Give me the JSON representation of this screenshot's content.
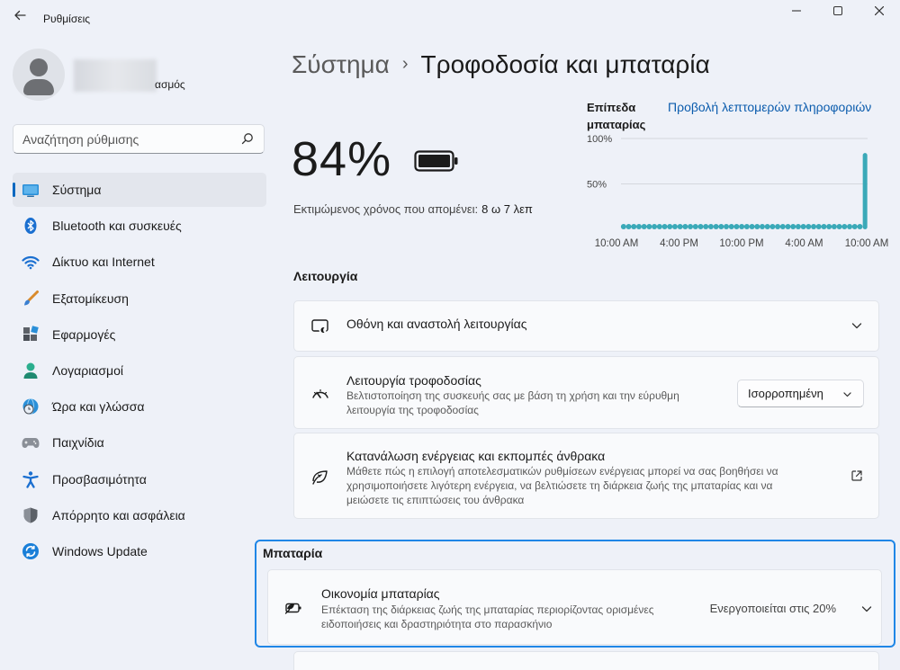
{
  "window": {
    "title": "Ρυθμίσεις",
    "back_icon": "back-arrow-icon",
    "minimize_icon": "minimize-icon",
    "maximize_icon": "maximize-icon",
    "close_icon": "close-icon"
  },
  "profile": {
    "name_visible": "ασμός"
  },
  "search": {
    "placeholder": "Αναζήτηση ρύθμισης",
    "icon": "search-icon"
  },
  "sidebar": {
    "items": [
      {
        "label": "Σύστημα",
        "icon": "system-display-icon",
        "active": true
      },
      {
        "label": "Bluetooth και συσκευές",
        "icon": "bluetooth-icon"
      },
      {
        "label": "Δίκτυο και Internet",
        "icon": "wifi-icon"
      },
      {
        "label": "Εξατομίκευση",
        "icon": "paintbrush-icon"
      },
      {
        "label": "Εφαρμογές",
        "icon": "apps-icon"
      },
      {
        "label": "Λογαριασμοί",
        "icon": "account-icon"
      },
      {
        "label": "Ώρα και γλώσσα",
        "icon": "globe-clock-icon"
      },
      {
        "label": "Παιχνίδια",
        "icon": "gamepad-icon"
      },
      {
        "label": "Προσβασιμότητα",
        "icon": "accessibility-icon"
      },
      {
        "label": "Απόρρητο και ασφάλεια",
        "icon": "shield-icon"
      },
      {
        "label": "Windows Update",
        "icon": "windows-update-icon"
      }
    ]
  },
  "header": {
    "parent": "Σύστημα",
    "separator": "›",
    "current": "Τροφοδοσία και μπαταρία"
  },
  "battery": {
    "percent": "84%",
    "remaining_label": "Εκτιμώμενος χρόνος που απομένει:",
    "remaining_value": "8 ω 7 λεπ"
  },
  "chart_data": {
    "type": "bar",
    "title": "Επίπεδα μπαταρίας",
    "link": "Προβολή λεπτομερών πληροφοριών",
    "ylabels": [
      "100%",
      "50%"
    ],
    "ylim": [
      0,
      100
    ],
    "x_tick_labels": [
      "10:00 AM",
      "4:00 PM",
      "10:00 PM",
      "4:00 AM",
      "10:00 AM"
    ],
    "values": [
      0,
      0,
      0,
      0,
      0,
      0,
      0,
      0,
      0,
      0,
      0,
      0,
      0,
      0,
      0,
      0,
      0,
      0,
      0,
      0,
      0,
      0,
      0,
      0,
      0,
      0,
      0,
      0,
      0,
      0,
      0,
      0,
      0,
      0,
      0,
      0,
      0,
      0,
      0,
      0,
      0,
      0,
      0,
      0,
      0,
      0,
      0,
      84
    ],
    "bar_color": "#3aa9b8",
    "grid": true
  },
  "sections": {
    "mode_heading": "Λειτουργία",
    "battery_heading": "Μπαταρία"
  },
  "cards": {
    "screen_sleep": {
      "title": "Οθόνη και αναστολή λειτουργίας",
      "icon": "screen-sleep-icon"
    },
    "power_mode": {
      "title": "Λειτουργία τροφοδοσίας",
      "desc": "Βελτιστοποίηση της συσκευής σας με βάση τη χρήση και την εύρυθμη λειτουργία της τροφοδοσίας",
      "icon": "power-mode-gauge-icon",
      "dropdown_value": "Ισορροπημένη"
    },
    "energy": {
      "title": "Κατανάλωση ενέργειας και εκπομπές άνθρακα",
      "desc": "Μάθετε πώς η επιλογή αποτελεσματικών ρυθμίσεων ενέργειας μπορεί να σας βοηθήσει να χρησιμοποιήσετε λιγότερη ενέργεια, να βελτιώσετε τη διάρκεια ζωής της μπαταρίας και να μειώσετε τις επιπτώσεις του άνθρακα",
      "icon": "leaf-icon",
      "action_icon": "external-link-icon"
    },
    "battery_saver": {
      "title": "Οικονομία μπαταρίας",
      "desc": "Επέκταση της διάρκειας ζωής της μπαταρίας περιορίζοντας ορισμένες ειδοποιήσεις και δραστηριότητα στο παρασκήνιο",
      "status": "Ενεργοποιείται στις 20%",
      "icon": "battery-saver-icon"
    }
  },
  "colors": {
    "accent": "#0067c0",
    "focus_border": "#1f86e6",
    "link": "#0b5cad"
  }
}
